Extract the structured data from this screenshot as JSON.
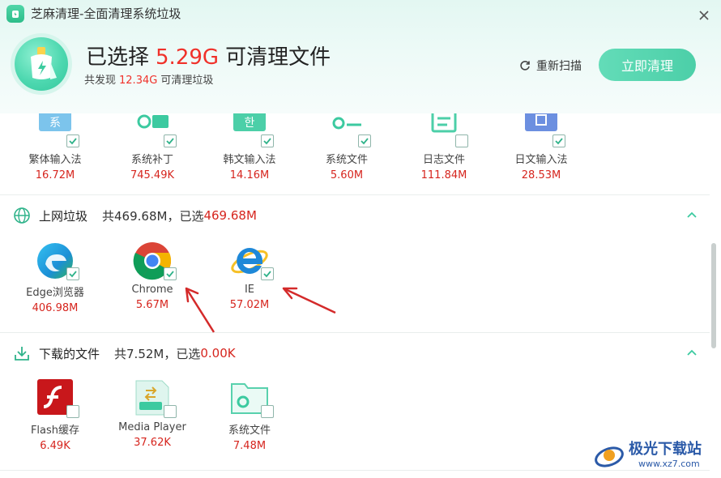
{
  "window": {
    "title": "芝麻清理-全面清理系统垃圾"
  },
  "summary": {
    "selected_prefix": "已选择",
    "selected_size": "5.29G",
    "selected_suffix": "可清理文件",
    "found_prefix": "共发现",
    "found_size": "12.34G",
    "found_suffix": "可清理垃圾"
  },
  "actions": {
    "rescan": "重新扫描",
    "clean_now": "立即清理"
  },
  "top_row": [
    {
      "label": "繁体输入法",
      "size": "16.72M",
      "checked": true
    },
    {
      "label": "系统补丁",
      "size": "745.49K",
      "checked": true
    },
    {
      "label": "韩文输入法",
      "size": "14.16M",
      "checked": true
    },
    {
      "label": "系统文件",
      "size": "5.60M",
      "checked": true
    },
    {
      "label": "日志文件",
      "size": "111.84M",
      "checked": false
    },
    {
      "label": "日文输入法",
      "size": "28.53M",
      "checked": true
    }
  ],
  "internet": {
    "title": "上网垃圾",
    "total": "共469.68M，已选",
    "selected": "469.68M",
    "items": [
      {
        "label": "Edge浏览器",
        "size": "406.98M",
        "checked": true
      },
      {
        "label": "Chrome",
        "size": "5.67M",
        "checked": true
      },
      {
        "label": "IE",
        "size": "57.02M",
        "checked": true
      }
    ]
  },
  "downloads": {
    "title": "下载的文件",
    "total": "共7.52M，已选",
    "selected": "0.00K",
    "items": [
      {
        "label": "Flash缓存",
        "size": "6.49K",
        "checked": false
      },
      {
        "label": "Media Player",
        "size": "37.62K",
        "checked": false
      },
      {
        "label": "系统文件",
        "size": "7.48M",
        "checked": false
      }
    ]
  },
  "watermark": {
    "title": "极光下载站",
    "url": "www.xz7.com"
  },
  "colors": {
    "accent_red": "#d6251e",
    "brand_green": "#4ccfa8",
    "annotation_arrow": "#d42a2a"
  }
}
